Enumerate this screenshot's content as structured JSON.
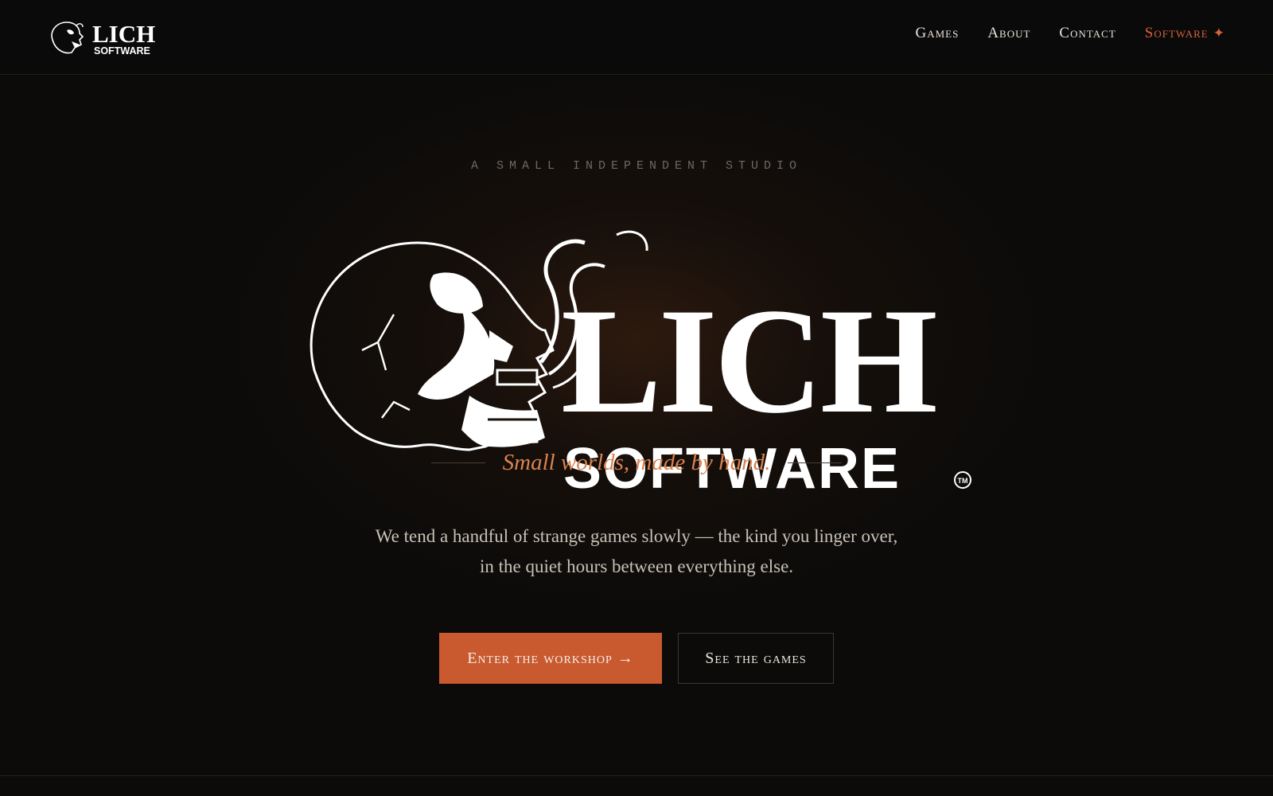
{
  "brand": {
    "logo_text_top": "LICH",
    "logo_text_bottom": "SOFTWARE"
  },
  "nav": {
    "items": [
      {
        "label": "Games"
      },
      {
        "label": "About"
      },
      {
        "label": "Contact"
      },
      {
        "label": "Software",
        "icon": "sparkle-icon",
        "active": true
      }
    ],
    "star_glyph": "✦"
  },
  "hero": {
    "eyebrow": "A SMALL INDEPENDENT STUDIO",
    "logo_text_top": "LICH",
    "logo_text_bottom": "SOFTWARE",
    "logo_mark": "TM",
    "tagline": "Small worlds, made by hand.",
    "blurb_line1": "We tend a handful of strange games slowly — the kind you linger over,",
    "blurb_line2": "in the quiet hours between everything else.",
    "primary_cta": "Enter the workshop →",
    "secondary_cta": "See the games"
  },
  "colors": {
    "accent": "#c95a30",
    "tagline": "#d9834f",
    "background": "#0c0b0a",
    "text": "#e9e4dc"
  }
}
